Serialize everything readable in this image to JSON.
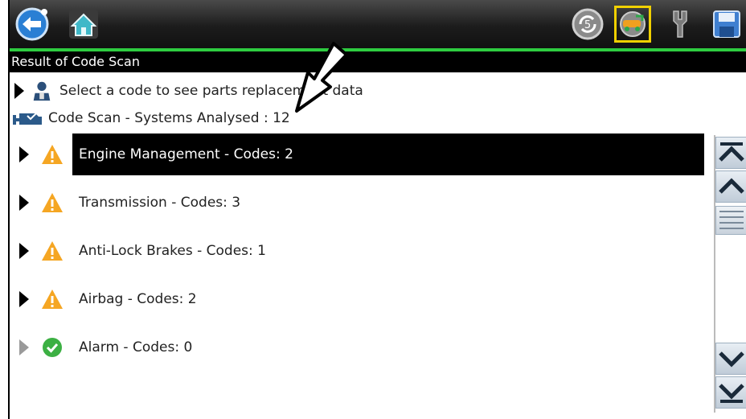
{
  "toolbar": {
    "back_icon": "back-arrow-icon",
    "home_icon": "home-icon",
    "right_icons": [
      "refresh-codes-icon",
      "vehicle-info-icon",
      "tools-icon",
      "save-icon"
    ]
  },
  "title_bar": {
    "text": "Result of Code Scan"
  },
  "hint_row": {
    "text": "Select a code to see parts replacement data"
  },
  "summary_row": {
    "text": "Code Scan - Systems Analysed : 12"
  },
  "systems": [
    {
      "label": "Engine Management - Codes: 2",
      "status": "warning",
      "selected": true
    },
    {
      "label": "Transmission - Codes: 3",
      "status": "warning",
      "selected": false
    },
    {
      "label": "Anti-Lock Brakes - Codes: 1",
      "status": "warning",
      "selected": false
    },
    {
      "label": "Airbag - Codes: 2",
      "status": "warning",
      "selected": false
    },
    {
      "label": "Alarm - Codes: 0",
      "status": "ok",
      "selected": false
    }
  ],
  "colors": {
    "accent_line": "#2ecc40",
    "warning": "#f5a623",
    "ok": "#3cb043",
    "selected_bg": "#000000"
  }
}
